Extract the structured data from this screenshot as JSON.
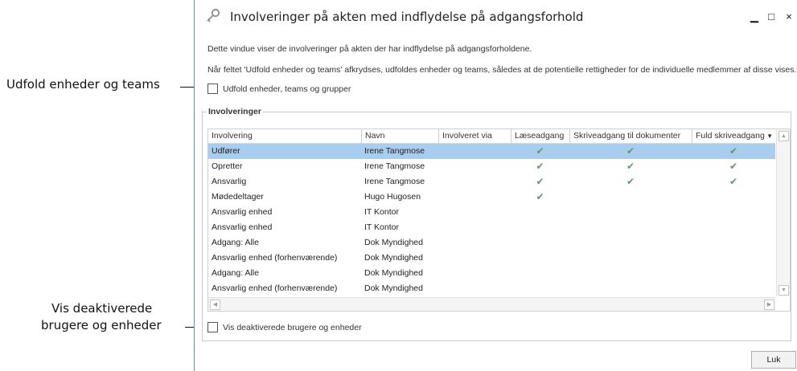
{
  "callouts": {
    "expand": "Udfold enheder og teams",
    "deactivated_line1": "Vis deaktiverede",
    "deactivated_line2": "brugere og enheder"
  },
  "window": {
    "title": "Involveringer på akten med indflydelse på adgangsforhold",
    "minimize_glyph": "▁",
    "maximize_glyph": "□",
    "close_glyph": "×"
  },
  "description": {
    "line1": "Dette vindue viser de involveringer på akten der har indflydelse på adgangsforholdene.",
    "line2": "Når feltet 'Udfold enheder og teams' afkrydses, udfoldes enheder og teams, således at de potentielle rettigheder for de individuelle medlemmer af disse vises."
  },
  "expand_checkbox": {
    "label": "Udfold enheder, teams og grupper",
    "checked": false
  },
  "group": {
    "title": "Involveringer"
  },
  "table": {
    "columns": [
      "Involvering",
      "Navn",
      "Involveret via",
      "Læseadgang",
      "Skriveadgang til dokumenter",
      "Fuld skriveadgang"
    ],
    "check_glyph": "✔",
    "rows": [
      {
        "involvering": "Udfører",
        "navn": "Irene Tangmose",
        "via": "",
        "laes": true,
        "skriv": true,
        "fuld": true,
        "selected": true
      },
      {
        "involvering": "Opretter",
        "navn": "Irene Tangmose",
        "via": "",
        "laes": true,
        "skriv": true,
        "fuld": true
      },
      {
        "involvering": "Ansvarlig",
        "navn": "Irene Tangmose",
        "via": "",
        "laes": true,
        "skriv": true,
        "fuld": true
      },
      {
        "involvering": "Mødedeltager",
        "navn": "Hugo Hugosen",
        "via": "",
        "laes": true,
        "skriv": false,
        "fuld": false
      },
      {
        "involvering": "Ansvarlig enhed",
        "navn": "IT Kontor",
        "via": "",
        "laes": false,
        "skriv": false,
        "fuld": false
      },
      {
        "involvering": "Ansvarlig enhed",
        "navn": "IT Kontor",
        "via": "",
        "laes": false,
        "skriv": false,
        "fuld": false
      },
      {
        "involvering": "Adgang: Alle",
        "navn": "Dok Myndighed",
        "via": "",
        "laes": false,
        "skriv": false,
        "fuld": false
      },
      {
        "involvering": "Ansvarlig enhed (forhenværende)",
        "navn": "Dok Myndighed",
        "via": "",
        "laes": false,
        "skriv": false,
        "fuld": false
      },
      {
        "involvering": "Adgang: Alle",
        "navn": "Dok Myndighed",
        "via": "",
        "laes": false,
        "skriv": false,
        "fuld": false
      },
      {
        "involvering": "Ansvarlig enhed (forhenværende)",
        "navn": "Dok Myndighed",
        "via": "",
        "laes": false,
        "skriv": false,
        "fuld": false
      }
    ]
  },
  "deactivated_checkbox": {
    "label": "Vis deaktiverede brugere og enheder",
    "checked": false
  },
  "close_button": {
    "label": "Luk"
  },
  "colors": {
    "selected_row": "#a9cdef",
    "check": "#5a9a6a",
    "window_border": "#5b8fc2"
  }
}
